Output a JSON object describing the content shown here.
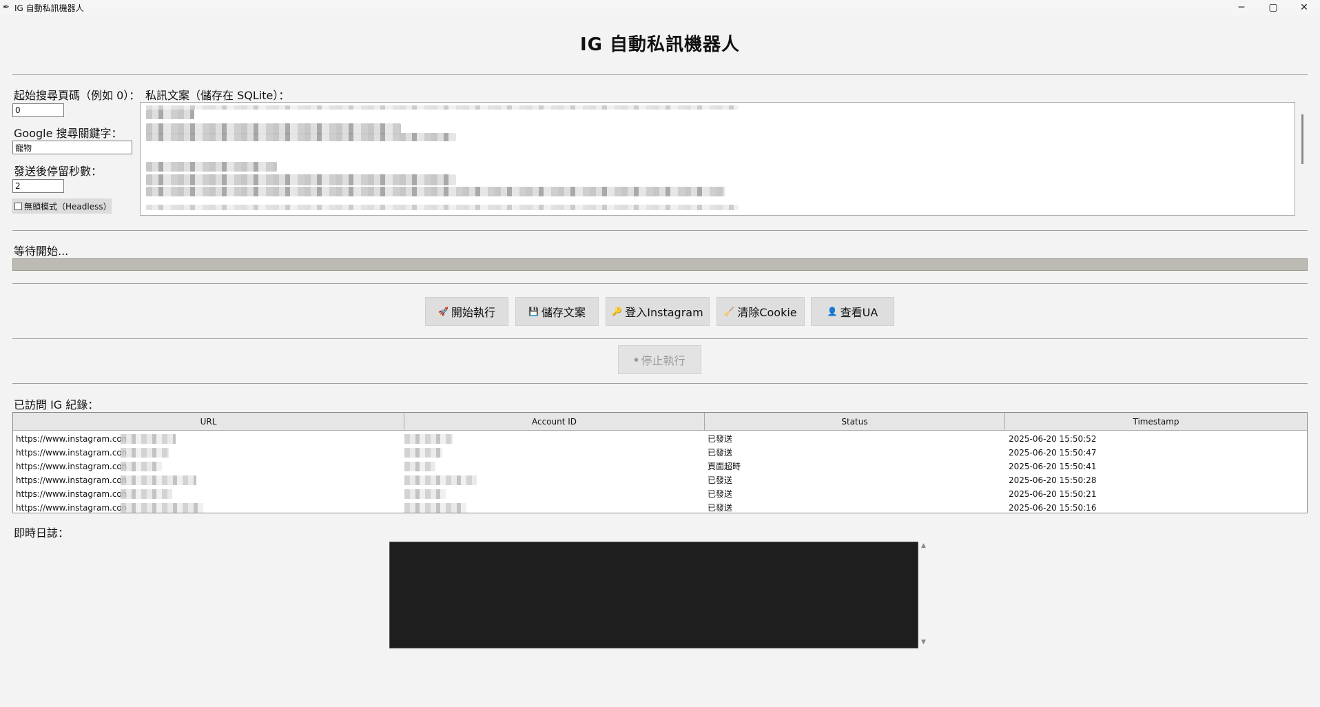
{
  "window": {
    "title": "IG 自動私訊機器人",
    "controls": {
      "minimize": "─",
      "maximize": "▢",
      "close": "✕"
    }
  },
  "heading": "IG 自動私訊機器人",
  "form": {
    "start_page_label": "起始搜尋頁碼（例如 0）：",
    "start_page_value": "0",
    "keyword_label": "Google 搜尋關鍵字：",
    "keyword_value": "寵物",
    "delay_label": "發送後停留秒數：",
    "delay_value": "2",
    "headless_label": "無頭模式（Headless）",
    "headless_checked": false,
    "message_label": "私訊文案（儲存在 SQLite）："
  },
  "status": {
    "text": "等待開始...",
    "progress": 0
  },
  "buttons": {
    "start": {
      "icon": "🚀",
      "label": "開始執行"
    },
    "save": {
      "icon": "💾",
      "label": "儲存文案"
    },
    "login": {
      "icon": "🔑",
      "label": "登入Instagram"
    },
    "clear_cookie": {
      "icon": "🧹",
      "label": "清除Cookie"
    },
    "view_ua": {
      "icon": "👤",
      "label": "查看UA"
    },
    "stop": {
      "icon": "⏺",
      "label": "停止執行"
    }
  },
  "visited": {
    "label": "已訪問 IG 紀錄：",
    "columns": [
      "URL",
      "Account ID",
      "Status",
      "Timestamp"
    ],
    "rows": [
      {
        "url": "https://www.instagram.con",
        "status": "已發送",
        "timestamp": "2025-06-20 15:50:52"
      },
      {
        "url": "https://www.instagram.con",
        "status": "已發送",
        "timestamp": "2025-06-20 15:50:47"
      },
      {
        "url": "https://www.instagram.con",
        "status": "頁面超時",
        "timestamp": "2025-06-20 15:50:41"
      },
      {
        "url": "https://www.instagram.con",
        "status": "已發送",
        "timestamp": "2025-06-20 15:50:28"
      },
      {
        "url": "https://www.instagram.con",
        "status": "已發送",
        "timestamp": "2025-06-20 15:50:21"
      },
      {
        "url": "https://www.instagram.con",
        "status": "已發送",
        "timestamp": "2025-06-20 15:50:16"
      }
    ]
  },
  "log": {
    "label": "即時日誌："
  },
  "colors": {
    "background": "#f3f3f3",
    "log_background": "#1e1e1e",
    "progress_track": "#bdbab3"
  }
}
